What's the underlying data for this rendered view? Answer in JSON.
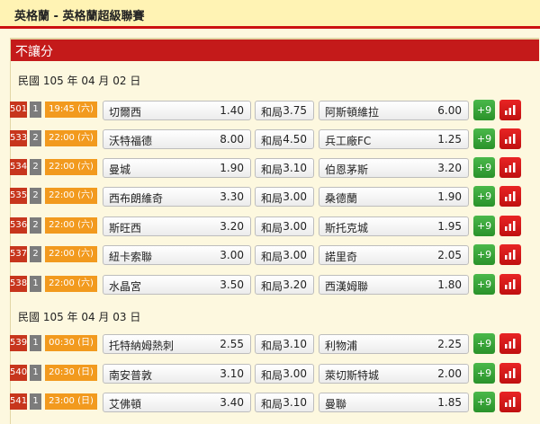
{
  "page_title": "英格蘭 - 英格蘭超級聯賽",
  "section_title": "不讓分",
  "groups": [
    {
      "date": "民國 105 年 04 月 02 日",
      "matches": [
        {
          "code": "501",
          "ch": "1",
          "time": "19:45 (六)",
          "home": "切爾西",
          "home_odds": "1.40",
          "draw": "和局",
          "draw_odds": "3.75",
          "away": "阿斯頓維拉",
          "away_odds": "6.00",
          "more": "+9"
        },
        {
          "code": "533",
          "ch": "2",
          "time": "22:00 (六)",
          "home": "沃特福德",
          "home_odds": "8.00",
          "draw": "和局",
          "draw_odds": "4.50",
          "away": "兵工廠FC",
          "away_odds": "1.25",
          "more": "+9"
        },
        {
          "code": "534",
          "ch": "2",
          "time": "22:00 (六)",
          "home": "曼城",
          "home_odds": "1.90",
          "draw": "和局",
          "draw_odds": "3.10",
          "away": "伯恩茅斯",
          "away_odds": "3.20",
          "more": "+9"
        },
        {
          "code": "535",
          "ch": "2",
          "time": "22:00 (六)",
          "home": "西布朗維奇",
          "home_odds": "3.30",
          "draw": "和局",
          "draw_odds": "3.00",
          "away": "桑德蘭",
          "away_odds": "1.90",
          "more": "+9"
        },
        {
          "code": "536",
          "ch": "2",
          "time": "22:00 (六)",
          "home": "斯旺西",
          "home_odds": "3.20",
          "draw": "和局",
          "draw_odds": "3.00",
          "away": "斯托克城",
          "away_odds": "1.95",
          "more": "+9"
        },
        {
          "code": "537",
          "ch": "2",
          "time": "22:00 (六)",
          "home": "紐卡索聯",
          "home_odds": "3.00",
          "draw": "和局",
          "draw_odds": "3.00",
          "away": "諾里奇",
          "away_odds": "2.05",
          "more": "+9"
        },
        {
          "code": "538",
          "ch": "1",
          "time": "22:00 (六)",
          "home": "水晶宮",
          "home_odds": "3.50",
          "draw": "和局",
          "draw_odds": "3.20",
          "away": "西漢姆聯",
          "away_odds": "1.80",
          "more": "+9"
        }
      ]
    },
    {
      "date": "民國 105 年 04 月 03 日",
      "matches": [
        {
          "code": "539",
          "ch": "1",
          "time": "00:30 (日)",
          "home": "托特納姆熱刺",
          "home_odds": "2.55",
          "draw": "和局",
          "draw_odds": "3.10",
          "away": "利物浦",
          "away_odds": "2.25",
          "more": "+9"
        },
        {
          "code": "540",
          "ch": "1",
          "time": "20:30 (日)",
          "home": "南安普敦",
          "home_odds": "3.10",
          "draw": "和局",
          "draw_odds": "3.00",
          "away": "萊切斯特城",
          "away_odds": "2.00",
          "more": "+9"
        },
        {
          "code": "541",
          "ch": "1",
          "time": "23:00 (日)",
          "home": "艾佛頓",
          "home_odds": "3.40",
          "draw": "和局",
          "draw_odds": "3.10",
          "away": "曼聯",
          "away_odds": "1.85",
          "more": "+9"
        }
      ]
    }
  ],
  "icons": {
    "chart_button": "bar-chart-icon"
  },
  "colors": {
    "accent_red": "#c41a1a",
    "code_bg": "#c7361d",
    "time_bg": "#f29a1e",
    "more_green": "#2a922a"
  }
}
